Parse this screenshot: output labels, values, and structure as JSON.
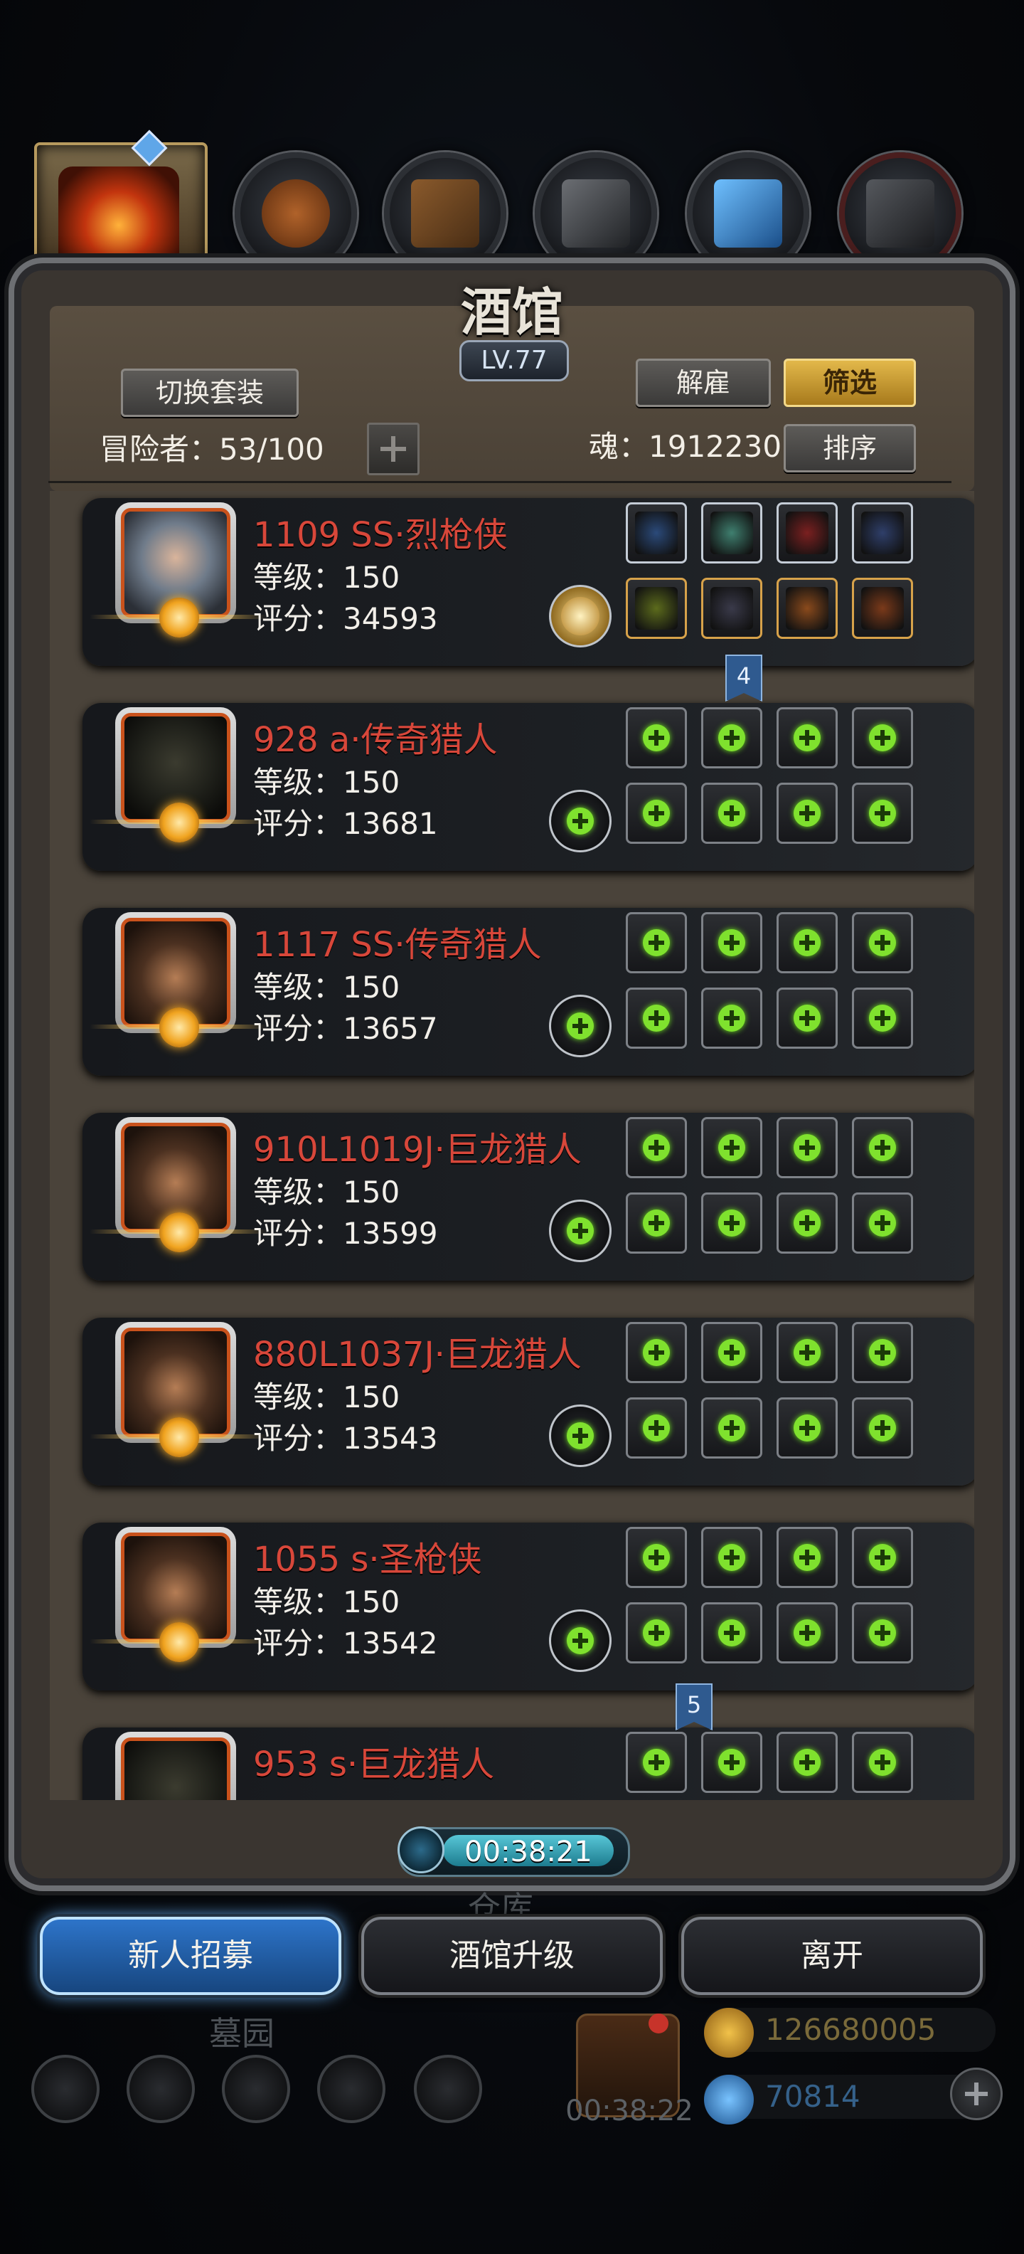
{
  "title": "酒馆",
  "level_badge": "LV.77",
  "buttons": {
    "switch_outfit": "切换套装",
    "dismiss": "解雇",
    "filter": "筛选",
    "sort": "排序"
  },
  "adventurers_label": "冒险者：53/100",
  "soul_label": "魂：1912230",
  "heroes": [
    {
      "name": "1109 SS·烈枪侠",
      "level": "等级：150",
      "score": "评分：34593",
      "portrait": "helm",
      "equipped": true
    },
    {
      "name": "928 a·传奇猎人",
      "level": "等级：150",
      "score": "评分：13681",
      "portrait": "hood",
      "equipped": false
    },
    {
      "name": "1117 SS·传奇猎人",
      "level": "等级：150",
      "score": "评分：13657",
      "portrait": "cowboy",
      "equipped": false
    },
    {
      "name": "910L1019J·巨龙猎人",
      "level": "等级：150",
      "score": "评分：13599",
      "portrait": "cowboy",
      "equipped": false
    },
    {
      "name": "880L1037J·巨龙猎人",
      "level": "等级：150",
      "score": "评分：13543",
      "portrait": "cowboy",
      "equipped": false
    },
    {
      "name": "1055 s·圣枪侠",
      "level": "等级：150",
      "score": "评分：13542",
      "portrait": "cowboy",
      "equipped": false
    },
    {
      "name": "953 s·巨龙猎人",
      "level": "",
      "score": "",
      "portrait": "hood",
      "equipped": false
    }
  ],
  "markers": [
    "4",
    "5"
  ],
  "timer": "00:38:21",
  "faded_labels": {
    "warehouse": "仓库",
    "graveyard": "墓园"
  },
  "bottom_buttons": {
    "recruit": "新人招募",
    "upgrade": "酒馆升级",
    "leave": "离开"
  },
  "gift_timer": "00:38:22",
  "resources": {
    "gold": "126680005",
    "gems": "70814"
  },
  "colors": {
    "hero_name": "#d8473a",
    "filter_gold": "#e2b84a",
    "plus_green": "#7fe12e",
    "recruit_blue": "#2d74c9"
  }
}
